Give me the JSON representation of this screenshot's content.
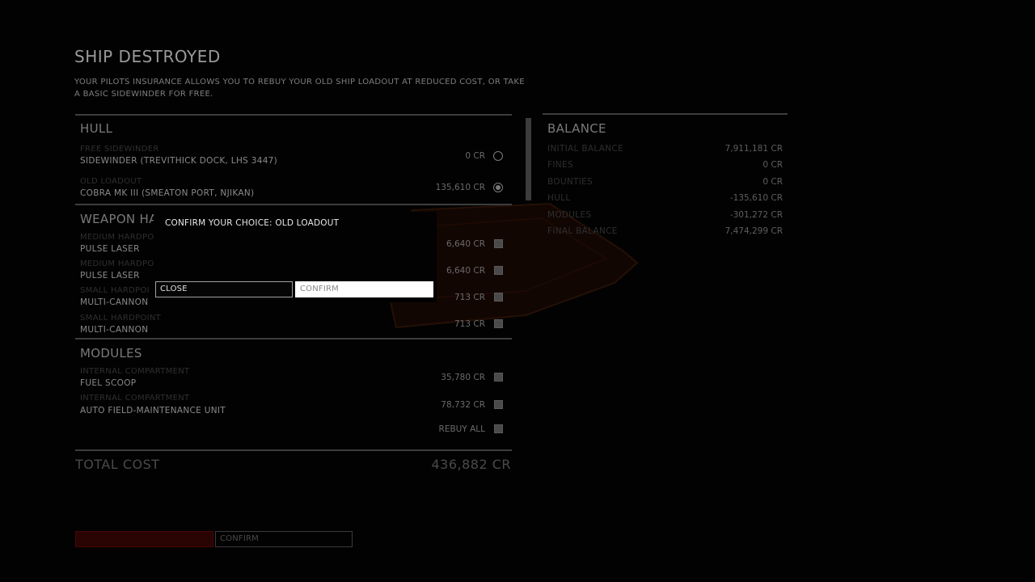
{
  "header": {
    "title": "SHIP DESTROYED",
    "description": "YOUR PILOTS INSURANCE ALLOWS YOU TO REBUY YOUR OLD SHIP LOADOUT AT REDUCED COST, OR TAKE A BASIC SIDEWINDER FOR FREE."
  },
  "hull": {
    "title": "HULL",
    "options": [
      {
        "category": "FREE SIDEWINDER",
        "name": "SIDEWINDER (TREVITHICK DOCK, LHS 3447)",
        "price": "0 CR",
        "selected": false
      },
      {
        "category": "OLD LOADOUT",
        "name": "COBRA MK III (SMEATON PORT, NJIKAN)",
        "price": "135,610 CR",
        "selected": true
      }
    ]
  },
  "weapons": {
    "title": "WEAPON HA",
    "items": [
      {
        "category": "MEDIUM HARDPO",
        "name": "PULSE LASER",
        "price": "6,640 CR"
      },
      {
        "category": "MEDIUM HARDPO",
        "name": "PULSE LASER",
        "price": "6,640 CR"
      },
      {
        "category": "SMALL HARDPOI",
        "name": "MULTI-CANNON",
        "price": "713 CR"
      },
      {
        "category": "SMALL HARDPOINT",
        "name": "MULTI-CANNON",
        "price": "713 CR"
      }
    ]
  },
  "modules": {
    "title": "MODULES",
    "items": [
      {
        "category": "INTERNAL COMPARTMENT",
        "name": "FUEL SCOOP",
        "price": "35,780 CR"
      },
      {
        "category": "INTERNAL COMPARTMENT",
        "name": "AUTO FIELD-MAINTENANCE UNIT",
        "price": "78,732 CR"
      }
    ],
    "rebuy_all_label": "REBUY ALL"
  },
  "total": {
    "label": "TOTAL COST",
    "value": "436,882 CR"
  },
  "balance": {
    "title": "BALANCE",
    "rows": [
      {
        "label": "INITIAL BALANCE",
        "value": "7,911,181 CR"
      },
      {
        "label": "FINES",
        "value": "0 CR"
      },
      {
        "label": "BOUNTIES",
        "value": "0 CR"
      },
      {
        "label": "HULL",
        "value": "-135,610 CR"
      },
      {
        "label": "MODULES",
        "value": "-301,272 CR"
      },
      {
        "label": "FINAL BALANCE",
        "value": "7,474,299 CR"
      }
    ]
  },
  "footer": {
    "confirm_label": "CONFIRM"
  },
  "dialog": {
    "message": "CONFIRM YOUR CHOICE:  OLD LOADOUT",
    "close_label": "CLOSE",
    "confirm_label": "CONFIRM"
  },
  "colors": {
    "accent_red": "#3a0505",
    "ship_glow": "#2a0c02"
  }
}
